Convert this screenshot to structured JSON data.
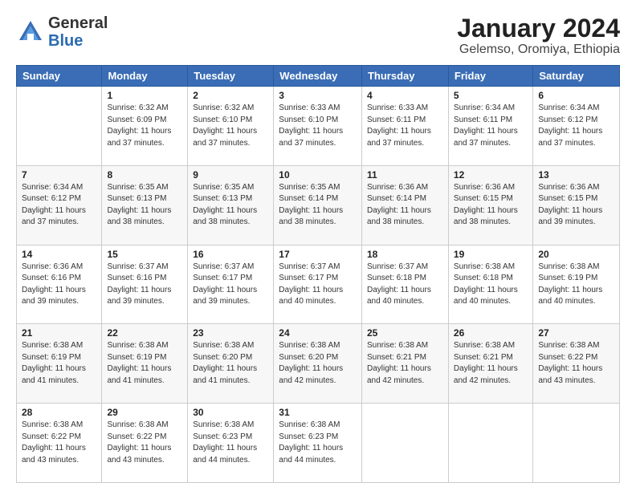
{
  "header": {
    "logo_general": "General",
    "logo_blue": "Blue",
    "title": "January 2024",
    "subtitle": "Gelemso, Oromiya, Ethiopia"
  },
  "weekdays": [
    "Sunday",
    "Monday",
    "Tuesday",
    "Wednesday",
    "Thursday",
    "Friday",
    "Saturday"
  ],
  "weeks": [
    [
      {
        "day": "",
        "info": ""
      },
      {
        "day": "1",
        "info": "Sunrise: 6:32 AM\nSunset: 6:09 PM\nDaylight: 11 hours\nand 37 minutes."
      },
      {
        "day": "2",
        "info": "Sunrise: 6:32 AM\nSunset: 6:10 PM\nDaylight: 11 hours\nand 37 minutes."
      },
      {
        "day": "3",
        "info": "Sunrise: 6:33 AM\nSunset: 6:10 PM\nDaylight: 11 hours\nand 37 minutes."
      },
      {
        "day": "4",
        "info": "Sunrise: 6:33 AM\nSunset: 6:11 PM\nDaylight: 11 hours\nand 37 minutes."
      },
      {
        "day": "5",
        "info": "Sunrise: 6:34 AM\nSunset: 6:11 PM\nDaylight: 11 hours\nand 37 minutes."
      },
      {
        "day": "6",
        "info": "Sunrise: 6:34 AM\nSunset: 6:12 PM\nDaylight: 11 hours\nand 37 minutes."
      }
    ],
    [
      {
        "day": "7",
        "info": "Sunrise: 6:34 AM\nSunset: 6:12 PM\nDaylight: 11 hours\nand 37 minutes."
      },
      {
        "day": "8",
        "info": "Sunrise: 6:35 AM\nSunset: 6:13 PM\nDaylight: 11 hours\nand 38 minutes."
      },
      {
        "day": "9",
        "info": "Sunrise: 6:35 AM\nSunset: 6:13 PM\nDaylight: 11 hours\nand 38 minutes."
      },
      {
        "day": "10",
        "info": "Sunrise: 6:35 AM\nSunset: 6:14 PM\nDaylight: 11 hours\nand 38 minutes."
      },
      {
        "day": "11",
        "info": "Sunrise: 6:36 AM\nSunset: 6:14 PM\nDaylight: 11 hours\nand 38 minutes."
      },
      {
        "day": "12",
        "info": "Sunrise: 6:36 AM\nSunset: 6:15 PM\nDaylight: 11 hours\nand 38 minutes."
      },
      {
        "day": "13",
        "info": "Sunrise: 6:36 AM\nSunset: 6:15 PM\nDaylight: 11 hours\nand 39 minutes."
      }
    ],
    [
      {
        "day": "14",
        "info": "Sunrise: 6:36 AM\nSunset: 6:16 PM\nDaylight: 11 hours\nand 39 minutes."
      },
      {
        "day": "15",
        "info": "Sunrise: 6:37 AM\nSunset: 6:16 PM\nDaylight: 11 hours\nand 39 minutes."
      },
      {
        "day": "16",
        "info": "Sunrise: 6:37 AM\nSunset: 6:17 PM\nDaylight: 11 hours\nand 39 minutes."
      },
      {
        "day": "17",
        "info": "Sunrise: 6:37 AM\nSunset: 6:17 PM\nDaylight: 11 hours\nand 40 minutes."
      },
      {
        "day": "18",
        "info": "Sunrise: 6:37 AM\nSunset: 6:18 PM\nDaylight: 11 hours\nand 40 minutes."
      },
      {
        "day": "19",
        "info": "Sunrise: 6:38 AM\nSunset: 6:18 PM\nDaylight: 11 hours\nand 40 minutes."
      },
      {
        "day": "20",
        "info": "Sunrise: 6:38 AM\nSunset: 6:19 PM\nDaylight: 11 hours\nand 40 minutes."
      }
    ],
    [
      {
        "day": "21",
        "info": "Sunrise: 6:38 AM\nSunset: 6:19 PM\nDaylight: 11 hours\nand 41 minutes."
      },
      {
        "day": "22",
        "info": "Sunrise: 6:38 AM\nSunset: 6:19 PM\nDaylight: 11 hours\nand 41 minutes."
      },
      {
        "day": "23",
        "info": "Sunrise: 6:38 AM\nSunset: 6:20 PM\nDaylight: 11 hours\nand 41 minutes."
      },
      {
        "day": "24",
        "info": "Sunrise: 6:38 AM\nSunset: 6:20 PM\nDaylight: 11 hours\nand 42 minutes."
      },
      {
        "day": "25",
        "info": "Sunrise: 6:38 AM\nSunset: 6:21 PM\nDaylight: 11 hours\nand 42 minutes."
      },
      {
        "day": "26",
        "info": "Sunrise: 6:38 AM\nSunset: 6:21 PM\nDaylight: 11 hours\nand 42 minutes."
      },
      {
        "day": "27",
        "info": "Sunrise: 6:38 AM\nSunset: 6:22 PM\nDaylight: 11 hours\nand 43 minutes."
      }
    ],
    [
      {
        "day": "28",
        "info": "Sunrise: 6:38 AM\nSunset: 6:22 PM\nDaylight: 11 hours\nand 43 minutes."
      },
      {
        "day": "29",
        "info": "Sunrise: 6:38 AM\nSunset: 6:22 PM\nDaylight: 11 hours\nand 43 minutes."
      },
      {
        "day": "30",
        "info": "Sunrise: 6:38 AM\nSunset: 6:23 PM\nDaylight: 11 hours\nand 44 minutes."
      },
      {
        "day": "31",
        "info": "Sunrise: 6:38 AM\nSunset: 6:23 PM\nDaylight: 11 hours\nand 44 minutes."
      },
      {
        "day": "",
        "info": ""
      },
      {
        "day": "",
        "info": ""
      },
      {
        "day": "",
        "info": ""
      }
    ]
  ]
}
